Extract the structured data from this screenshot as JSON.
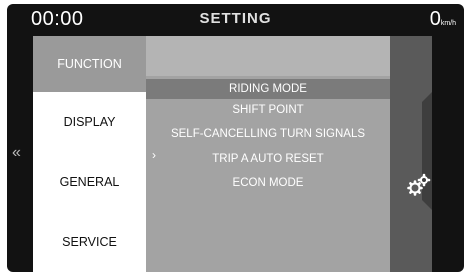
{
  "topbar": {
    "clock": "00:00",
    "title": "SETTING",
    "speed": "0",
    "speed_unit": "km/h"
  },
  "nav": {
    "back_glyph": "«",
    "items": [
      {
        "label": "FUNCTION",
        "active": false
      },
      {
        "label": "DISPLAY",
        "active": true
      },
      {
        "label": "GENERAL",
        "active": false
      },
      {
        "label": "SERVICE",
        "active": false
      }
    ]
  },
  "function_list": {
    "arrow_glyph": "›",
    "items": [
      {
        "label": "RIDING MODE",
        "selected": true
      },
      {
        "label": "SHIFT POINT",
        "selected": false
      },
      {
        "label": "SELF-CANCELLING TURN SIGNALS",
        "selected": false
      },
      {
        "label": "TRIP A AUTO RESET",
        "selected": false
      },
      {
        "label": "ECON MODE",
        "selected": false
      }
    ]
  },
  "side": {
    "icon": "gears-settings-icon"
  },
  "colors": {
    "background": "#121212",
    "menu_active": "#9a9a9a",
    "panel": "#a3a3a3",
    "selected_row": "#7b7b7b",
    "side_panel": "#5a5a5a"
  }
}
